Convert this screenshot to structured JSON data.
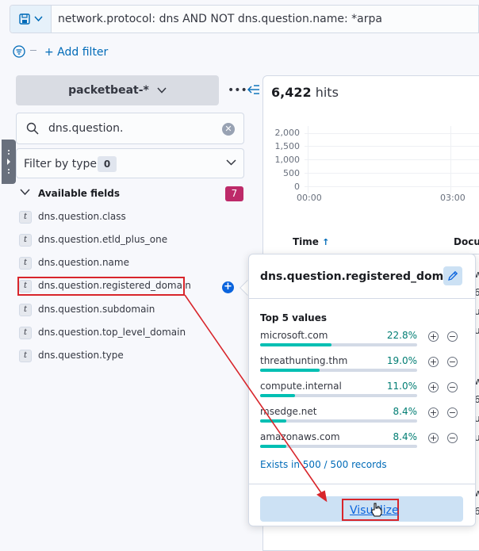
{
  "query": {
    "text": "network.protocol: dns AND NOT dns.question.name: *arpa"
  },
  "filter_bar": {
    "add_filter_label": "+ Add filter"
  },
  "sidebar": {
    "index_pattern": "packetbeat-*",
    "search_value": "dns.question.",
    "filter_by_type_label": "Filter by type",
    "filter_by_type_count": "0",
    "available_fields_label": "Available fields",
    "available_fields_count": "7",
    "fields": [
      {
        "type": "t",
        "name": "dns.question.class"
      },
      {
        "type": "t",
        "name": "dns.question.etld_plus_one"
      },
      {
        "type": "t",
        "name": "dns.question.name"
      },
      {
        "type": "t",
        "name": "dns.question.registered_domain"
      },
      {
        "type": "t",
        "name": "dns.question.subdomain"
      },
      {
        "type": "t",
        "name": "dns.question.top_level_domain"
      },
      {
        "type": "t",
        "name": "dns.question.type"
      }
    ]
  },
  "main": {
    "hits_count": "6,422",
    "hits_label": "hits",
    "chart_data": {
      "type": "bar",
      "y_ticks": [
        "2,000",
        "1,500",
        "1,000",
        "500",
        "0"
      ],
      "x_ticks": [
        "00:00",
        "03:00"
      ]
    },
    "table_headers": {
      "time": "Time",
      "time_sort_icon": "↑",
      "document": "Docum"
    }
  },
  "popover": {
    "title": "dns.question.registered_domain",
    "top_values_title": "Top 5 values",
    "values": [
      {
        "label": "microsoft.com",
        "percent_text": "22.8%",
        "percent": 22.8
      },
      {
        "label": "threathunting.thm",
        "percent_text": "19.0%",
        "percent": 19.0
      },
      {
        "label": "compute.internal",
        "percent_text": "11.0%",
        "percent": 11.0
      },
      {
        "label": "msedge.net",
        "percent_text": "8.4%",
        "percent": 8.4
      },
      {
        "label": "amazonaws.com",
        "percent_text": "8.4%",
        "percent": 8.4
      }
    ],
    "exists_text": "Exists in 500 / 500 records",
    "visualize_label": "Visualize"
  },
  "colors": {
    "accent": "#006bb8",
    "highlight": "#d8252b",
    "bar_fill": "#00bfb3",
    "available_badge": "#bd2a69"
  }
}
